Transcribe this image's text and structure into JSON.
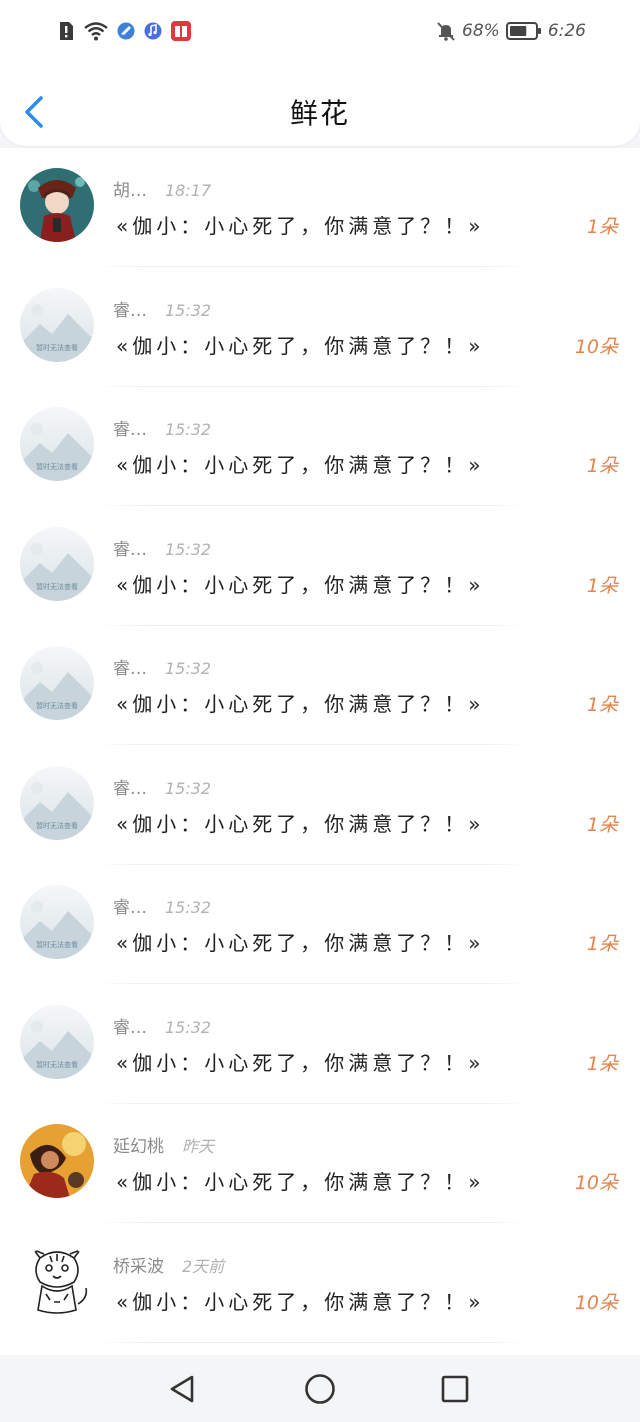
{
  "status_bar": {
    "left_icons": [
      "alert-icon",
      "wifi-icon",
      "browser-icon",
      "music-icon",
      "book-icon"
    ],
    "mute_icon": "bell-off-icon",
    "battery_percent": "68%",
    "battery_level": 0.68,
    "time": "6:26"
  },
  "header": {
    "title": "鲜花"
  },
  "list": {
    "items": [
      {
        "name": "胡…",
        "time": "18:17",
        "message": "«伽小：小心死了，你满意了？！»",
        "count": "1朵",
        "avatar": "anime-character"
      },
      {
        "name": "睿…",
        "time": "15:32",
        "message": "«伽小：小心死了，你满意了？！»",
        "count": "10朵",
        "avatar": "placeholder"
      },
      {
        "name": "睿…",
        "time": "15:32",
        "message": "«伽小：小心死了，你满意了？！»",
        "count": "1朵",
        "avatar": "placeholder"
      },
      {
        "name": "睿…",
        "time": "15:32",
        "message": "«伽小：小心死了，你满意了？！»",
        "count": "1朵",
        "avatar": "placeholder"
      },
      {
        "name": "睿…",
        "time": "15:32",
        "message": "«伽小：小心死了，你满意了？！»",
        "count": "1朵",
        "avatar": "placeholder"
      },
      {
        "name": "睿…",
        "time": "15:32",
        "message": "«伽小：小心死了，你满意了？！»",
        "count": "1朵",
        "avatar": "placeholder"
      },
      {
        "name": "睿…",
        "time": "15:32",
        "message": "«伽小：小心死了，你满意了？！»",
        "count": "1朵",
        "avatar": "placeholder"
      },
      {
        "name": "睿…",
        "time": "15:32",
        "message": "«伽小：小心死了，你满意了？！»",
        "count": "1朵",
        "avatar": "placeholder"
      },
      {
        "name": "延幻桃",
        "time": "昨天",
        "message": "«伽小：小心死了，你满意了？！»",
        "count": "10朵",
        "avatar": "photo"
      },
      {
        "name": "桥采波",
        "time": "2天前",
        "message": "«伽小：小心死了，你满意了？！»",
        "count": "10朵",
        "avatar": "tiger-sketch"
      }
    ],
    "placeholder_avatar_text": "暂时无法查看"
  },
  "bottom_nav": {
    "items": [
      "back-triangle-icon",
      "home-circle-icon",
      "recents-square-icon"
    ]
  },
  "colors": {
    "accent_blue": "#2b8cf0",
    "count_orange": "#e2854f",
    "background": "#f4f5f7"
  }
}
